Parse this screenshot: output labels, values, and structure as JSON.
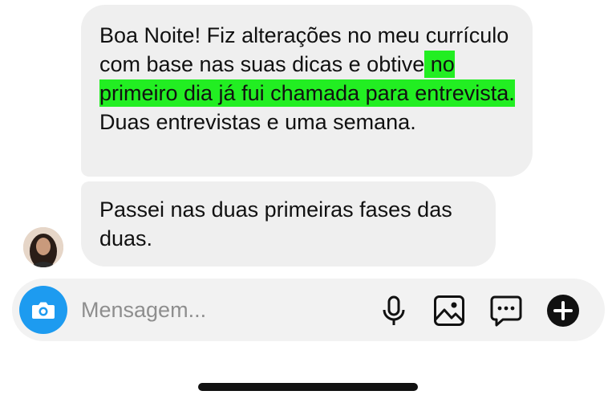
{
  "messages": [
    {
      "before": "Boa Noite! Fiz alterações no meu currículo com base nas suas dicas e obtive",
      "highlight": " no primeiro dia já fui chamada para entrevista.",
      "after": " Duas entrevistas e uma semana."
    },
    {
      "text": "Passei nas duas primeiras fases das duas."
    }
  ],
  "composer": {
    "placeholder": "Mensagem...",
    "icons": [
      "camera-icon",
      "microphone-icon",
      "image-icon",
      "sticker-chat-icon",
      "plus-icon"
    ]
  },
  "colors": {
    "bubble": "#efefef",
    "highlight": "#22ee22",
    "camera_button": "#1d9bf0",
    "placeholder_text": "#8e8e8e"
  }
}
